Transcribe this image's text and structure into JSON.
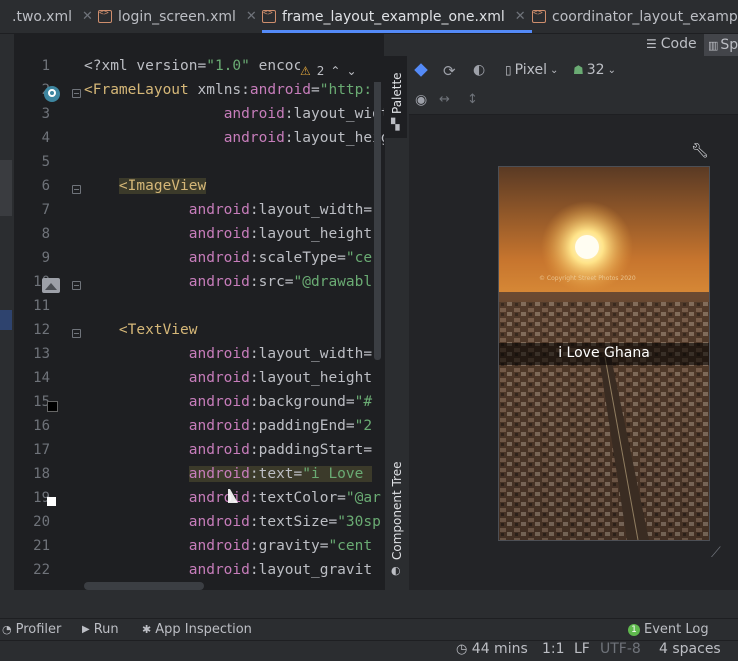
{
  "tabs": [
    {
      "label": ".two.xml",
      "active": false
    },
    {
      "label": "login_screen.xml",
      "active": false
    },
    {
      "label": "frame_layout_example_one.xml",
      "active": true
    },
    {
      "label": "coordinator_layout_exampl",
      "active": false
    }
  ],
  "view_modes": {
    "code": "Code",
    "split": "Sp"
  },
  "inspection": {
    "warnings": "2"
  },
  "side_panels": {
    "palette": "Palette",
    "component_tree": "Component Tree"
  },
  "design_toolbar": {
    "device": "Pixel",
    "api": "32"
  },
  "preview": {
    "textview_text": "i Love Ghana",
    "watermark": "© Copyright Street Photos 2020"
  },
  "line_numbers": [
    "1",
    "2",
    "3",
    "4",
    "5",
    "6",
    "7",
    "8",
    "9",
    "10",
    "11",
    "12",
    "13",
    "14",
    "15",
    "16",
    "17",
    "18",
    "19",
    "20",
    "21",
    "22"
  ],
  "code_lines": [
    [
      {
        "c": "t-plain",
        "t": "<?xml version="
      },
      {
        "c": "t-str",
        "t": "\"1.0\""
      },
      {
        "c": "t-plain",
        "t": " encoc"
      }
    ],
    [
      {
        "c": "t-tag",
        "t": "<FrameLayout "
      },
      {
        "c": "t-plain",
        "t": "xmlns:"
      },
      {
        "c": "t-ns",
        "t": "android"
      },
      {
        "c": "t-plain",
        "t": "="
      },
      {
        "c": "t-str",
        "t": "\"http:"
      }
    ],
    [
      {
        "c": "t-plain",
        "t": "                "
      },
      {
        "c": "t-ns",
        "t": "android"
      },
      {
        "c": "t-plain",
        "t": ":layout_width"
      }
    ],
    [
      {
        "c": "t-plain",
        "t": "                "
      },
      {
        "c": "t-ns",
        "t": "android"
      },
      {
        "c": "t-plain",
        "t": ":layout_heigh"
      }
    ],
    [],
    [
      {
        "c": "t-plain",
        "t": "    "
      },
      {
        "c": "t-tag",
        "t": "<ImageView"
      }
    ],
    [
      {
        "c": "t-plain",
        "t": "            "
      },
      {
        "c": "t-ns",
        "t": "android"
      },
      {
        "c": "t-plain",
        "t": ":layout_width="
      }
    ],
    [
      {
        "c": "t-plain",
        "t": "            "
      },
      {
        "c": "t-ns",
        "t": "android"
      },
      {
        "c": "t-plain",
        "t": ":layout_height"
      }
    ],
    [
      {
        "c": "t-plain",
        "t": "            "
      },
      {
        "c": "t-ns",
        "t": "android"
      },
      {
        "c": "t-plain",
        "t": ":scaleType="
      },
      {
        "c": "t-str",
        "t": "\"ce"
      }
    ],
    [
      {
        "c": "t-plain",
        "t": "            "
      },
      {
        "c": "t-ns",
        "t": "android"
      },
      {
        "c": "t-plain",
        "t": ":src="
      },
      {
        "c": "t-str",
        "t": "\"@drawabl"
      }
    ],
    [],
    [
      {
        "c": "t-plain",
        "t": "    "
      },
      {
        "c": "t-tag",
        "t": "<TextView"
      }
    ],
    [
      {
        "c": "t-plain",
        "t": "            "
      },
      {
        "c": "t-ns",
        "t": "android"
      },
      {
        "c": "t-plain",
        "t": ":layout_width="
      }
    ],
    [
      {
        "c": "t-plain",
        "t": "            "
      },
      {
        "c": "t-ns",
        "t": "android"
      },
      {
        "c": "t-plain",
        "t": ":layout_height"
      }
    ],
    [
      {
        "c": "t-plain",
        "t": "            "
      },
      {
        "c": "t-ns",
        "t": "android"
      },
      {
        "c": "t-plain",
        "t": ":background="
      },
      {
        "c": "t-str",
        "t": "\"#"
      }
    ],
    [
      {
        "c": "t-plain",
        "t": "            "
      },
      {
        "c": "t-ns",
        "t": "android"
      },
      {
        "c": "t-plain",
        "t": ":paddingEnd="
      },
      {
        "c": "t-str",
        "t": "\"2"
      }
    ],
    [
      {
        "c": "t-plain",
        "t": "            "
      },
      {
        "c": "t-ns",
        "t": "android"
      },
      {
        "c": "t-plain",
        "t": ":paddingStart="
      }
    ],
    [
      {
        "c": "t-plain",
        "t": "            "
      },
      {
        "c": "t-ns",
        "t": "android"
      },
      {
        "c": "t-plain",
        "t": ":text="
      },
      {
        "c": "t-str",
        "t": "\"i Love "
      }
    ],
    [
      {
        "c": "t-plain",
        "t": "            "
      },
      {
        "c": "t-ns",
        "t": "android"
      },
      {
        "c": "t-plain",
        "t": ":textColor="
      },
      {
        "c": "t-str",
        "t": "\"@ar"
      }
    ],
    [
      {
        "c": "t-plain",
        "t": "            "
      },
      {
        "c": "t-ns",
        "t": "android"
      },
      {
        "c": "t-plain",
        "t": ":textSize="
      },
      {
        "c": "t-str",
        "t": "\"30sp"
      }
    ],
    [
      {
        "c": "t-plain",
        "t": "            "
      },
      {
        "c": "t-ns",
        "t": "android"
      },
      {
        "c": "t-plain",
        "t": ":gravity="
      },
      {
        "c": "t-str",
        "t": "\"cent"
      }
    ],
    [
      {
        "c": "t-plain",
        "t": "            "
      },
      {
        "c": "t-ns",
        "t": "android"
      },
      {
        "c": "t-plain",
        "t": ":layout_gravit"
      }
    ]
  ],
  "bottom_tools": {
    "profiler": "Profiler",
    "run": "Run",
    "app_inspection": "App Inspection",
    "event_log": "Event Log"
  },
  "status": {
    "time": "44 mins",
    "position": "1:1",
    "line_sep": "LF",
    "encoding": "UTF-8",
    "indent": "4 spaces"
  },
  "colors": {
    "accent": "#548af7",
    "tag": "#d5b778",
    "namespace": "#c77dbb",
    "string": "#6aab73"
  }
}
